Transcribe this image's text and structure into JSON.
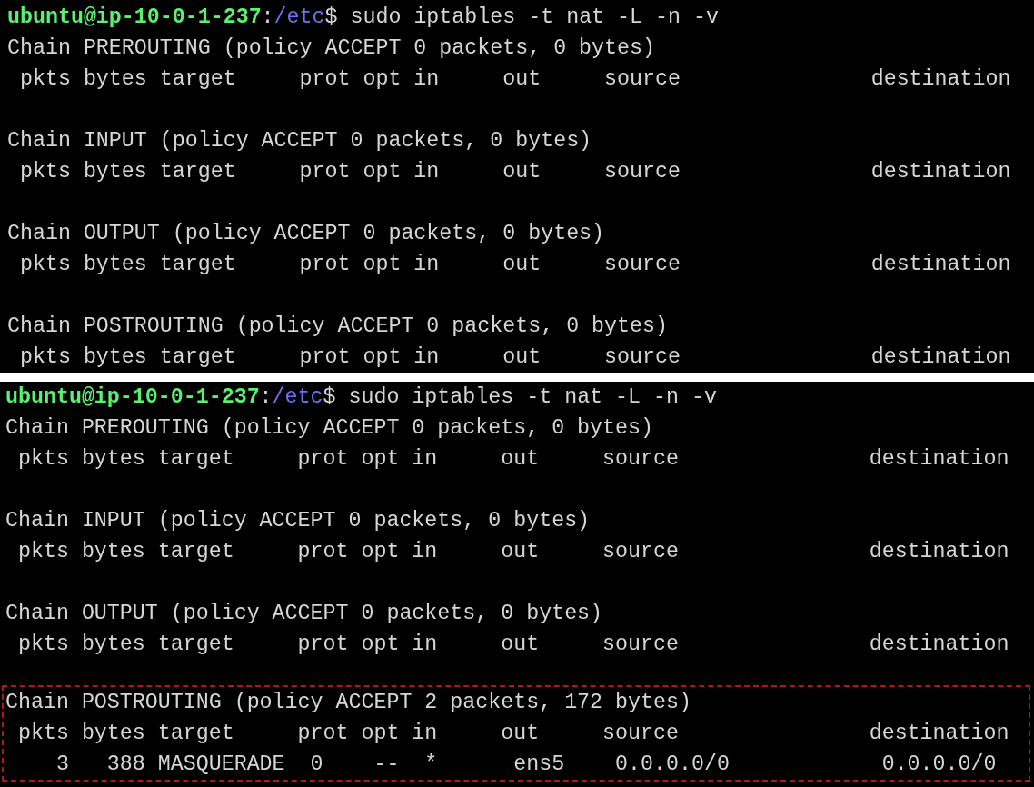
{
  "panels": [
    {
      "prompt": {
        "user_host": "ubuntu@ip-10-0-1-237",
        "separator": ":",
        "path": "/etc",
        "symbol": "$",
        "command": " sudo iptables -t nat -L -n -v"
      },
      "chains": [
        {
          "title": "Chain PREROUTING (policy ACCEPT 0 packets, 0 bytes)",
          "header": " pkts bytes target     prot opt in     out     source               destination",
          "highlighted": false
        },
        {
          "title": "Chain INPUT (policy ACCEPT 0 packets, 0 bytes)",
          "header": " pkts bytes target     prot opt in     out     source               destination",
          "highlighted": false
        },
        {
          "title": "Chain OUTPUT (policy ACCEPT 0 packets, 0 bytes)",
          "header": " pkts bytes target     prot opt in     out     source               destination",
          "highlighted": false
        },
        {
          "title": "Chain POSTROUTING (policy ACCEPT 0 packets, 0 bytes)",
          "header": " pkts bytes target     prot opt in     out     source               destination",
          "highlighted": false
        }
      ]
    },
    {
      "prompt": {
        "user_host": "ubuntu@ip-10-0-1-237",
        "separator": ":",
        "path": "/etc",
        "symbol": "$",
        "command": " sudo iptables -t nat -L -n -v"
      },
      "chains": [
        {
          "title": "Chain PREROUTING (policy ACCEPT 0 packets, 0 bytes)",
          "header": " pkts bytes target     prot opt in     out     source               destination",
          "highlighted": false
        },
        {
          "title": "Chain INPUT (policy ACCEPT 0 packets, 0 bytes)",
          "header": " pkts bytes target     prot opt in     out     source               destination",
          "highlighted": false
        },
        {
          "title": "Chain OUTPUT (policy ACCEPT 0 packets, 0 bytes)",
          "header": " pkts bytes target     prot opt in     out     source               destination",
          "highlighted": false
        },
        {
          "title": "Chain POSTROUTING (policy ACCEPT 2 packets, 172 bytes)",
          "header": " pkts bytes target     prot opt in     out     source               destination",
          "rows": [
            "    3   388 MASQUERADE  0    --  *      ens5    0.0.0.0/0            0.0.0.0/0"
          ],
          "highlighted": true
        }
      ]
    }
  ]
}
